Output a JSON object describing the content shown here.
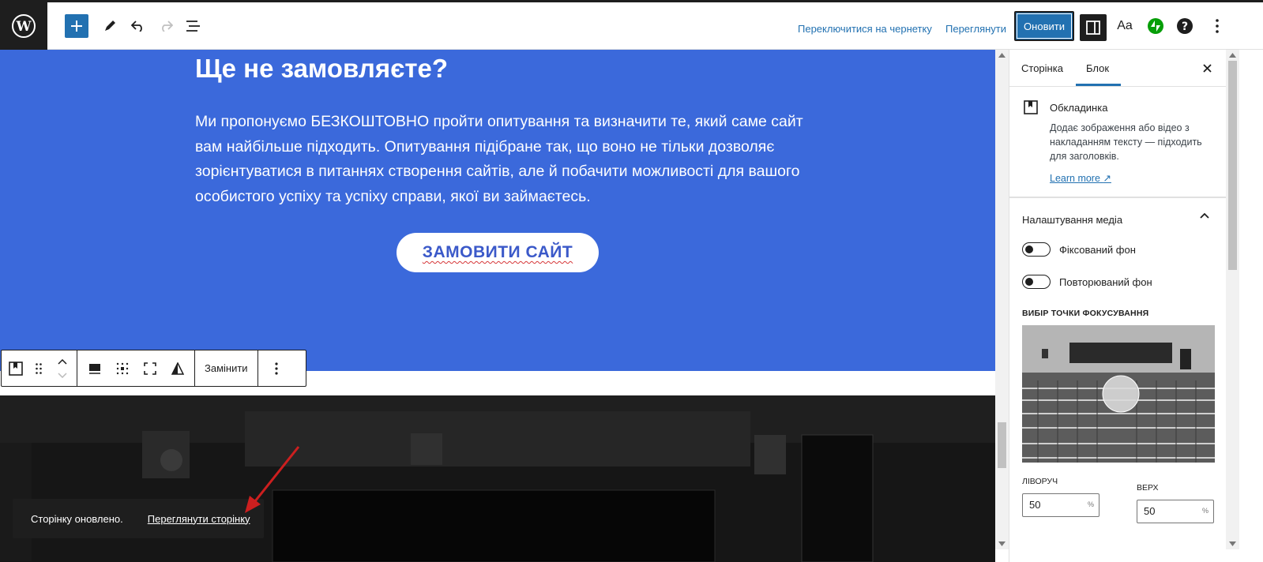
{
  "topbar": {
    "switch_to_draft": "Переключитися на чернетку",
    "preview": "Переглянути",
    "update": "Оновити",
    "typography_label": "Aa"
  },
  "canvas": {
    "heading": "Ще не замовляєте?",
    "paragraph": "Ми пропонуємо БЕЗКОШТОВНО пройти опитування та визначити те, який саме сайт вам найбільше підходить. Опитування підібране так, що воно не тільки дозволяє зорієнтуватися в питаннях створення сайтів, але й побачити можливості для вашого особистого успіху та успіху справи, якої ви займаєтесь.",
    "button": "ЗАМОВИТИ САЙТ",
    "colors": {
      "cover": "#3b69db",
      "button_text": "#3b59c9"
    }
  },
  "block_toolbar": {
    "replace": "Замінити"
  },
  "snackbar": {
    "message": "Сторінку оновлено.",
    "link": "Переглянути сторінку"
  },
  "sidebar": {
    "tabs": [
      "Сторінка",
      "Блок"
    ],
    "block_title": "Обкладинка",
    "block_desc": "Додає зображення або відео з накладанням тексту — підходить для заголовків.",
    "learn_more": "Learn more",
    "panel_title": "Налаштування медіа",
    "toggles": [
      "Фіксований фон",
      "Повторюваний фон"
    ],
    "focal_label": "Вибір точки фокусування",
    "left_label": "Ліворуч",
    "top_label": "Верх",
    "left_value": "50",
    "top_value": "50",
    "pct": "%"
  }
}
